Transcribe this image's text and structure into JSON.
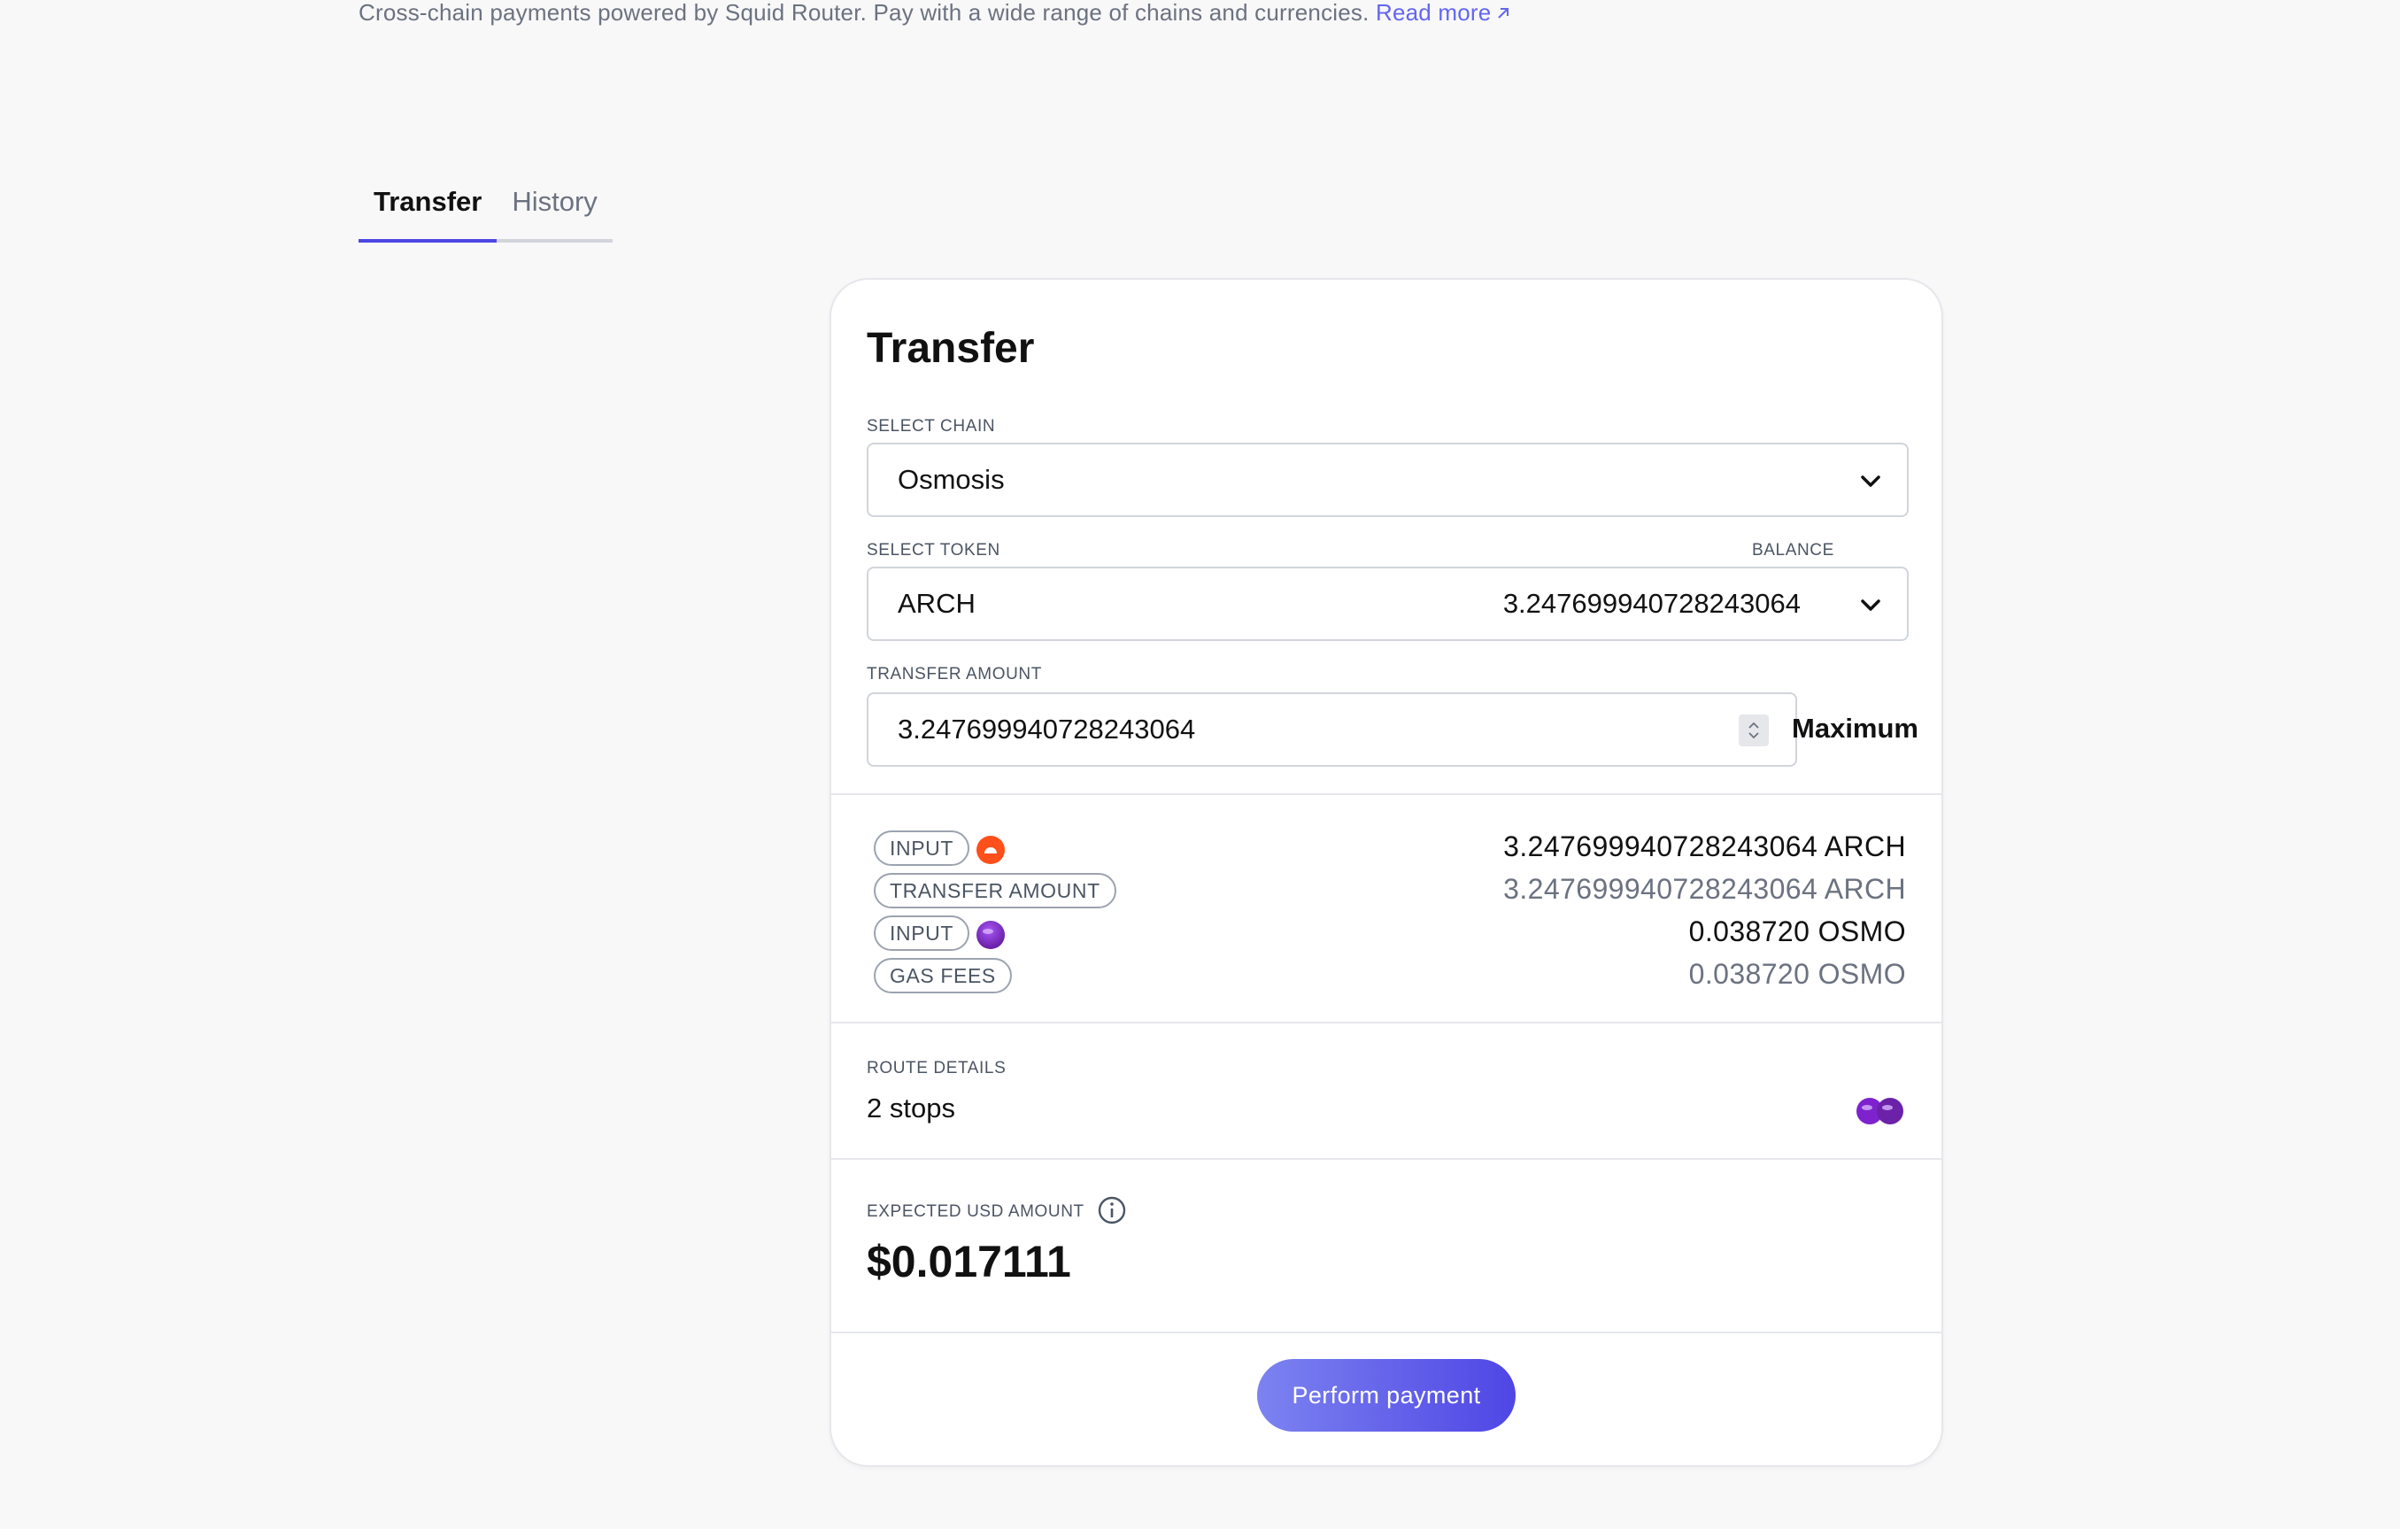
{
  "intro": {
    "text": "Cross-chain payments powered by Squid Router. Pay with a wide range of chains and currencies.",
    "link_label": "Read more",
    "link_icon": "arrow-up-right-icon"
  },
  "tabs": [
    {
      "label": "Transfer",
      "active": true
    },
    {
      "label": "History",
      "active": false
    }
  ],
  "card": {
    "title": "Transfer",
    "chain": {
      "label": "SELECT CHAIN",
      "value": "Osmosis",
      "icon": "chevron-down-icon"
    },
    "token": {
      "label": "SELECT TOKEN",
      "balance_label": "BALANCE",
      "value": "ARCH",
      "balance": "3.247699940728243064",
      "icon": "chevron-down-icon"
    },
    "amount": {
      "label": "TRANSFER AMOUNT",
      "value": "3.247699940728243064",
      "max_label": "Maximum"
    },
    "summary": [
      {
        "tag": "INPUT",
        "coin": "arch-coin-icon",
        "amount": "3.247699940728243064 ARCH",
        "tone": "dark"
      },
      {
        "tag": "TRANSFER AMOUNT",
        "coin": "",
        "amount": "3.247699940728243064 ARCH",
        "tone": "muted"
      },
      {
        "tag": "INPUT",
        "coin": "osmo-coin-icon",
        "amount": "0.038720 OSMO",
        "tone": "dark"
      },
      {
        "tag": "GAS FEES",
        "coin": "",
        "amount": "0.038720 OSMO",
        "tone": "muted"
      }
    ],
    "route": {
      "label": "ROUTE DETAILS",
      "value": "2 stops"
    },
    "usd": {
      "label": "EXPECTED USD AMOUNT",
      "value": "$0.017111"
    },
    "pay_button": "Perform payment"
  },
  "colors": {
    "accent": "#4f46e5",
    "arch": "#ff4f1a",
    "osmo": "#7e22ce",
    "link": "#6366f1"
  }
}
